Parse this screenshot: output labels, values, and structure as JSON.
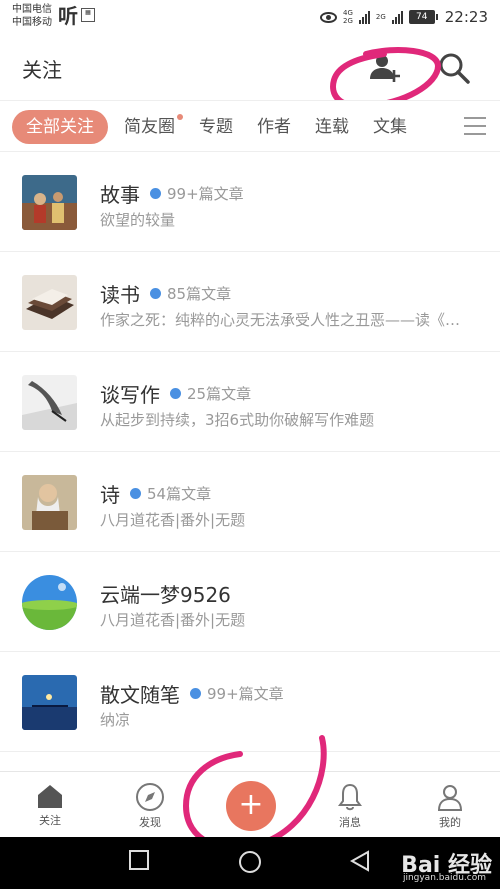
{
  "status_bar": {
    "carrier_1": "中国电信",
    "carrier_2": "中国移动",
    "net_1": "4G",
    "net_1b": "2G",
    "net_2": "2G",
    "battery": "74",
    "time": "22:23"
  },
  "header": {
    "title": "关注",
    "icons": [
      "add-user-icon",
      "search-icon"
    ]
  },
  "tabs": [
    {
      "label": "全部关注",
      "active": true
    },
    {
      "label": "简友圈",
      "has_dot": true
    },
    {
      "label": "专题"
    },
    {
      "label": "作者"
    },
    {
      "label": "连载"
    },
    {
      "label": "文集"
    }
  ],
  "list": [
    {
      "name": "故事",
      "count": "99+篇文章",
      "desc": "欲望的较量",
      "dot": true
    },
    {
      "name": "读书",
      "count": "85篇文章",
      "desc": "作家之死：纯粹的心灵无法承受人性之丑恶——读《…",
      "dot": true
    },
    {
      "name": "谈写作",
      "count": "25篇文章",
      "desc": "从起步到持续，3招6式助你破解写作难题",
      "dot": true
    },
    {
      "name": "诗",
      "count": "54篇文章",
      "desc": "八月道花香|番外|无题",
      "dot": true
    },
    {
      "name": "云端一梦9526",
      "count": "",
      "desc": "八月道花香|番外|无题",
      "dot": false
    },
    {
      "name": "散文随笔",
      "count": "99+篇文章",
      "desc": "纳凉",
      "dot": true
    }
  ],
  "bottom_nav": [
    {
      "label": "关注",
      "icon": "home-icon"
    },
    {
      "label": "发现",
      "icon": "compass-icon"
    },
    {
      "label": "",
      "icon": "plus-icon"
    },
    {
      "label": "消息",
      "icon": "bell-icon"
    },
    {
      "label": "我的",
      "icon": "person-icon"
    }
  ],
  "fab_symbol": "+",
  "watermark": "Bai 经验",
  "watermark_sub": "jingyan.baidu.com",
  "colors": {
    "accent": "#e78a78",
    "fab": "#e8765f",
    "dot_blue": "#4a90e2",
    "ink_annotation": "#e0287a"
  }
}
